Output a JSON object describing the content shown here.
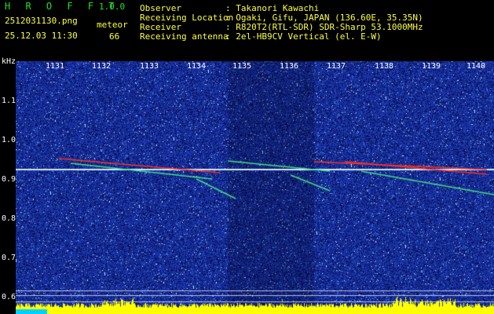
{
  "app": {
    "name": "H R O F F T",
    "version": "1.0.0"
  },
  "file": {
    "name": "2512031130.png",
    "datetime": "25.12.03 11:30"
  },
  "meteor": {
    "label": "meteor",
    "count": "66"
  },
  "info": [
    {
      "label": "Observer",
      "value": ": Takanori Kawachi"
    },
    {
      "label": "Receiving Location",
      "value": ": Ogaki, Gifu, JAPAN (136.60E, 35.35N)"
    },
    {
      "label": "Receiver",
      "value": ": R820T2(RTL-SDR) SDR-Sharp 53.1000MHz"
    },
    {
      "label": "Receiving antenna",
      "value": ": 2el-HB9CV Vertical (el. E-W)"
    }
  ],
  "axis": {
    "y_unit": "kHz",
    "y_ticks": [
      "1.1",
      "1.0",
      "0.9",
      "0.8",
      "0.7",
      "0.6"
    ],
    "x_ticks": [
      "1131",
      "1132",
      "1133",
      "1134",
      "1135",
      "1136",
      "1137",
      "1138",
      "1139",
      "1140"
    ]
  },
  "colors": {
    "background": "#000000",
    "title_green": "#20e020",
    "info_yellow": "#ffff40",
    "noise_blue": "#1a2fa8",
    "carrier_line": "#d0e8ff",
    "meteor_red": "#ff3020",
    "meteor_green": "#40e080",
    "level_yellow": "#ffff00",
    "level_cyan": "#00d0ff"
  }
}
